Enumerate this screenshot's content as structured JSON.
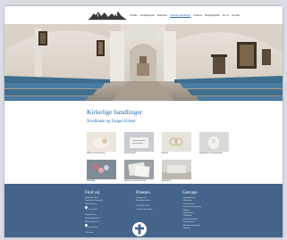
{
  "header": {
    "nav": [
      "Forside",
      "Gudstjenester",
      "Aktiviteter",
      "Kirkelige Handlinger",
      "Kirkerne",
      "Menighedsråd",
      "Om os",
      "Kontakt"
    ]
  },
  "main": {
    "title": "Kirkelige handlinger",
    "section_title": "Nordlunde og Fangel Kirker",
    "cards": [
      {
        "label": "Dåb og navngivning"
      },
      {
        "label": "Konfirmation"
      },
      {
        "label": "Bryllup"
      },
      {
        "label": "Begravelse og bisættelse"
      },
      {
        "label": "Dødsfald"
      },
      {
        "label": "Attester og dokumenter"
      },
      {
        "label": "Sjælesorg"
      }
    ]
  },
  "footer": {
    "col1": {
      "title": "Find vej",
      "lines_a": [
        "Nordlunde Kirke",
        "Nordlunde Kirkevej 1",
        "5000 Odense"
      ],
      "pin_label_a": "Vis på kort",
      "lines_b": [
        "Fangel Kirke",
        "Fangel Bygade 2",
        "5260 Odense S"
      ],
      "pin_label_b": "Vis på kort",
      "link": "» Kirkerne"
    },
    "col2": {
      "title": "Præsten",
      "lines": [
        "Sognepræst",
        "Kontakt præsten",
        "Tlf. 66 00 00 00",
        "Træffes efter aftale"
      ]
    },
    "col3": {
      "title": "Genveje",
      "items": [
        "Gudstjenester",
        "Aktiviteter",
        "Konfirmation",
        "Dåb og navngivning",
        "Bryllup",
        "Begravelse",
        "Kirkeblad",
        "Menighedsrådet",
        "Kirkegården",
        "Ansatte og frivillige",
        "Kontakt"
      ]
    }
  }
}
